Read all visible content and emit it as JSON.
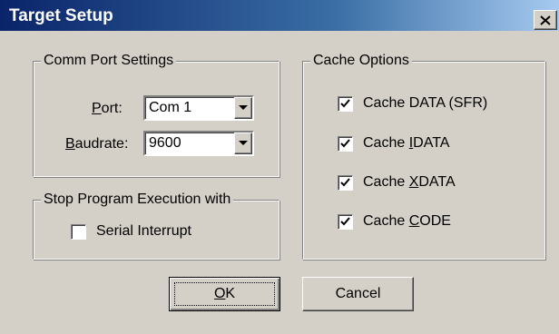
{
  "window": {
    "title": "Target Setup",
    "close_icon": "close-icon"
  },
  "comm_port": {
    "legend": "Comm Port Settings",
    "port_label_accel": "P",
    "port_label_rest": "ort:",
    "port_value": "Com 1",
    "baud_label_accel": "B",
    "baud_label_rest": "audrate:",
    "baud_value": "9600"
  },
  "stop_exec": {
    "legend": "Stop Program Execution with",
    "serial_interrupt": {
      "label": "Serial Interrupt",
      "checked": false
    }
  },
  "cache": {
    "legend": "Cache Options",
    "items": [
      {
        "pre": "Cache DATA (SFR)",
        "accel": "",
        "post": "",
        "checked": true
      },
      {
        "pre": "Cache ",
        "accel": "I",
        "post": "DATA",
        "checked": true
      },
      {
        "pre": "Cache ",
        "accel": "X",
        "post": "DATA",
        "checked": true
      },
      {
        "pre": "Cache ",
        "accel": "C",
        "post": "ODE",
        "checked": true
      }
    ]
  },
  "buttons": {
    "ok_accel": "O",
    "ok_rest": "K",
    "cancel": "Cancel"
  }
}
